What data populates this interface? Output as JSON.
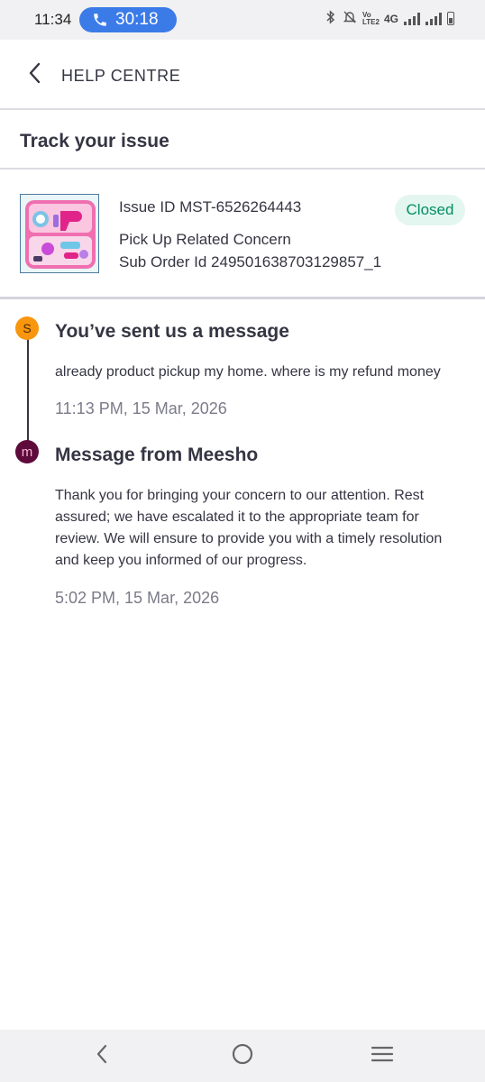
{
  "status_bar": {
    "time": "11:34",
    "call_timer": "30:18",
    "network_label": "4G",
    "volte_label": "Vo LTE2"
  },
  "header": {
    "title": "HELP CENTRE"
  },
  "page": {
    "section_title": "Track your issue"
  },
  "issue": {
    "id_text": "Issue ID MST-6526264443",
    "status": "Closed",
    "concern": "Pick Up Related Concern",
    "sub_order": "Sub Order Id 249501638703129857_1"
  },
  "timeline": [
    {
      "avatar_letter": "S",
      "title": "You’ve sent us a message",
      "body": "already product pickup my home. where is my refund money",
      "timestamp": "11:13 PM, 15 Mar, 2026"
    },
    {
      "avatar_letter": "m",
      "title": "Message from Meesho",
      "body": "Thank you for bringing your concern to our attention. Rest assured; we have escalated it to the appropriate team for review. We will ensure to provide you with a timely resolution and keep you informed of our progress.",
      "timestamp": "5:02 PM, 15 Mar, 2026"
    }
  ],
  "colors": {
    "call_pill": "#3b7be8",
    "closed_badge_bg": "#e3f6ef",
    "closed_badge_text": "#038d63",
    "user_avatar": "#f8960f",
    "meesho_avatar": "#5e0b3b"
  },
  "icons": {
    "back": "chevron-left-icon",
    "call": "phone-icon",
    "nav_back": "nav-back-icon",
    "nav_home": "nav-home-icon",
    "nav_menu": "nav-menu-icon"
  }
}
